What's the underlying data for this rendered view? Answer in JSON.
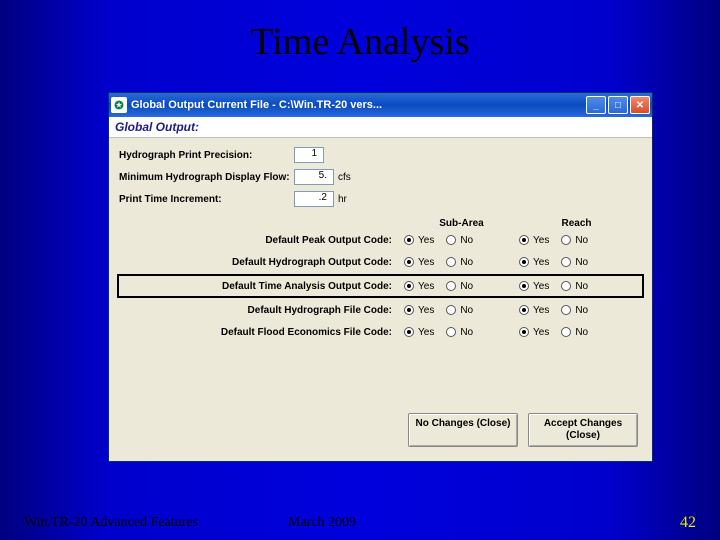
{
  "slide": {
    "title": "Time Analysis",
    "footer_left": "Win.TR-20 Advanced Features",
    "footer_center": "March 2009",
    "page_number": "42"
  },
  "window": {
    "title": "Global Output   Current File - C:\\Win.TR-20 vers...",
    "subheader": "Global Output:",
    "fields": {
      "precision": {
        "label": "Hydrograph Print Precision:",
        "value": "1"
      },
      "min_flow": {
        "label": "Minimum Hydrograph Display Flow:",
        "value": "5.",
        "unit": "cfs"
      },
      "increment": {
        "label": "Print Time Increment:",
        "value": ".2",
        "unit": "hr"
      }
    },
    "columns": {
      "sub_area": "Sub-Area",
      "reach": "Reach"
    },
    "yesno": {
      "yes": "Yes",
      "no": "No"
    },
    "options": [
      {
        "label": "Default Peak Output Code:",
        "sub_area": "yes",
        "reach": "yes",
        "highlight": false
      },
      {
        "label": "Default Hydrograph Output Code:",
        "sub_area": "yes",
        "reach": "yes",
        "highlight": false
      },
      {
        "label": "Default Time Analysis Output Code:",
        "sub_area": "yes",
        "reach": "yes",
        "highlight": true
      },
      {
        "label": "Default Hydrograph File Code:",
        "sub_area": "yes",
        "reach": "yes",
        "highlight": false
      },
      {
        "label": "Default Flood Economics File Code:",
        "sub_area": "yes",
        "reach": "yes",
        "highlight": false
      }
    ],
    "buttons": {
      "no_changes": "No Changes\n(Close)",
      "accept": "Accept Changes\n(Close)"
    }
  }
}
